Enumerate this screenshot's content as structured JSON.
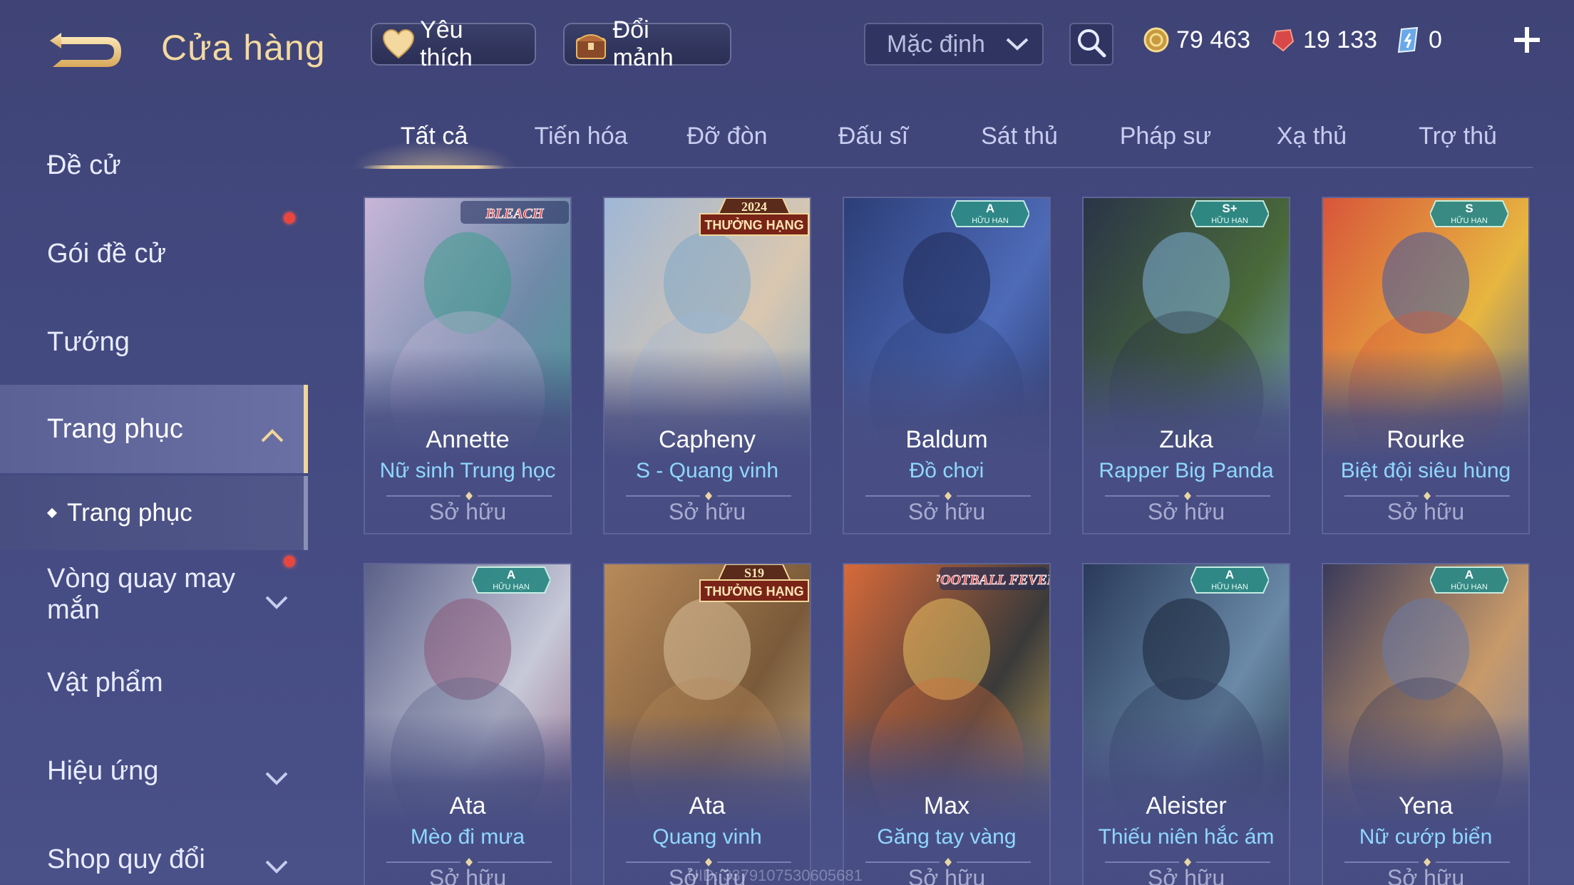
{
  "header": {
    "title": "Cửa hàng",
    "favorite_label": "Yêu thích",
    "fragment_label": "Đổi mảnh",
    "sort_value": "Mặc định",
    "currencies": {
      "gold": "79 463",
      "voucher": "19 133",
      "quan_huy": "0"
    }
  },
  "sidebar": {
    "items": [
      {
        "label": "Đề cử"
      },
      {
        "label": "Gói đề cử"
      },
      {
        "label": "Tướng"
      },
      {
        "label": "Trang phục"
      },
      {
        "label": "Vòng quay may mắn"
      },
      {
        "label": "Vật phẩm"
      },
      {
        "label": "Hiệu ứng"
      },
      {
        "label": "Shop quy đổi"
      }
    ],
    "sub_item": "Trang phục"
  },
  "tabs": [
    "Tất cả",
    "Tiến hóa",
    "Đỡ đòn",
    "Đấu sĩ",
    "Sát thủ",
    "Pháp sư",
    "Xạ thủ",
    "Trợ thủ"
  ],
  "cards": [
    {
      "hero": "Annette",
      "skin": "Nữ sinh Trung học",
      "status": "Sở hữu",
      "badge": "BLEACH",
      "badge_sub": "",
      "palette": [
        "#c8b6d8",
        "#6e8aa8",
        "#3e9c8e"
      ]
    },
    {
      "hero": "Capheny",
      "skin": "S - Quang vinh",
      "status": "Sở hữu",
      "badge": "THƯỞNG HẠNG",
      "badge_sub": "2024",
      "palette": [
        "#9fb7d6",
        "#d9c7b0",
        "#7fa7c9"
      ]
    },
    {
      "hero": "Baldum",
      "skin": "Đồ chơi",
      "status": "Sở hữu",
      "badge": "A",
      "badge_sub": "HỮU HẠN",
      "palette": [
        "#2c3e78",
        "#4e6bb8",
        "#1f2a55"
      ]
    },
    {
      "hero": "Zuka",
      "skin": "Rapper Big Panda",
      "status": "Sở hữu",
      "badge": "S+",
      "badge_sub": "HỮU HẠN",
      "palette": [
        "#2a3448",
        "#4a6a3a",
        "#7fb0d8"
      ]
    },
    {
      "hero": "Rourke",
      "skin": "Biệt đội siêu hùng",
      "status": "Sở hữu",
      "badge": "S",
      "badge_sub": "HỮU HẠN",
      "palette": [
        "#d8553a",
        "#e7b640",
        "#3a5aa8"
      ]
    },
    {
      "hero": "Ata",
      "skin": "Mèo đi mưa",
      "status": "Sở hữu",
      "badge": "A",
      "badge_sub": "HỮU HẠN",
      "palette": [
        "#5a6088",
        "#c7c9d8",
        "#8a5a7a"
      ]
    },
    {
      "hero": "Ata",
      "skin": "Quang vinh",
      "status": "Sở hữu",
      "badge": "S19",
      "badge_sub": "THƯỞNG HẠNG",
      "palette": [
        "#b88a5a",
        "#7a5a3a",
        "#d8c09a"
      ]
    },
    {
      "hero": "Max",
      "skin": "Găng tay vàng",
      "status": "Sở hữu",
      "badge": "FOOTBALL FEVER",
      "badge_sub": "",
      "palette": [
        "#d86a3a",
        "#3a3a3a",
        "#e8c060"
      ]
    },
    {
      "hero": "Aleister",
      "skin": "Thiếu niên hắc ám",
      "status": "Sở hữu",
      "badge": "A",
      "badge_sub": "HỮU HẠN",
      "palette": [
        "#2a3a5a",
        "#6a8aa8",
        "#1a2438"
      ]
    },
    {
      "hero": "Yena",
      "skin": "Nữ cướp biển",
      "status": "Sở hữu",
      "badge": "A",
      "badge_sub": "HỮU HẠN",
      "palette": [
        "#3a3a5a",
        "#c89a6a",
        "#6a7aa8"
      ]
    }
  ],
  "uid_text": "UID: 3379107530605681",
  "colors": {
    "accent_gold": "#f2d79a",
    "skin_name": "#8fd7ff",
    "badge_red": "#e8463e"
  }
}
